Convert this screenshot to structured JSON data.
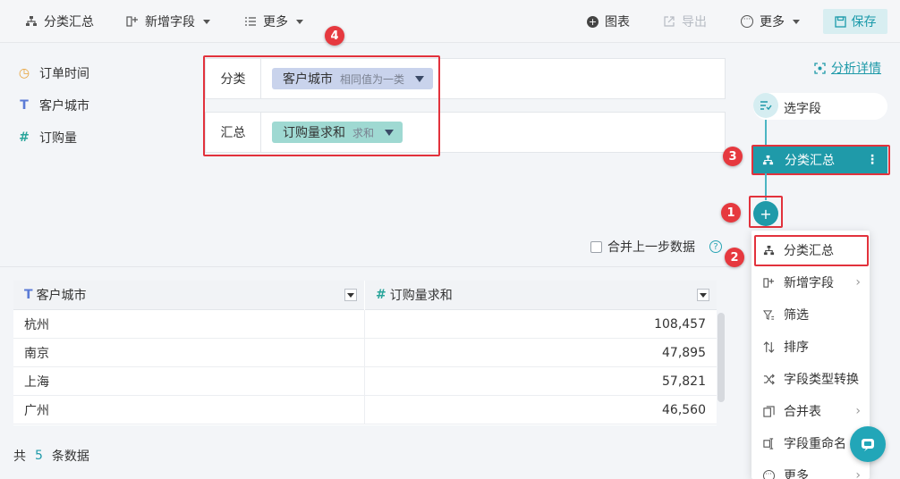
{
  "toolbar": {
    "group_summary": "分类汇总",
    "add_field": "新增字段",
    "more_left": "更多",
    "chart": "图表",
    "export": "导出",
    "more_right": "更多",
    "save": "保存"
  },
  "fields": [
    {
      "label": "订单时间",
      "icon": "clock-icon"
    },
    {
      "label": "客户城市",
      "icon": "text-type-icon"
    },
    {
      "label": "订购量",
      "icon": "number-type-icon"
    }
  ],
  "config": {
    "group_label": "分类",
    "group_field": "客户城市",
    "group_mode": "相同值为一类",
    "summary_label": "汇总",
    "summary_field": "订购量求和",
    "summary_mode": "求和"
  },
  "merge_checkbox_label": "合并上一步数据",
  "table": {
    "columns": [
      {
        "label": "客户城市",
        "type_icon": "T"
      },
      {
        "label": "订购量求和",
        "type_icon": "#"
      }
    ],
    "rows": [
      [
        "杭州",
        "108,457"
      ],
      [
        "南京",
        "47,895"
      ],
      [
        "上海",
        "57,821"
      ],
      [
        "广州",
        "46,560"
      ]
    ]
  },
  "footer": {
    "prefix": "共",
    "count": "5",
    "suffix": "条数据"
  },
  "right_panel": {
    "analysis_detail": "分析详情",
    "step_select": "选字段",
    "step_active": "分类汇总"
  },
  "menu": {
    "items": [
      {
        "label": "分类汇总",
        "icon": "group-icon",
        "submenu": false
      },
      {
        "label": "新增字段",
        "icon": "add-field-icon",
        "submenu": true
      },
      {
        "label": "筛选",
        "icon": "filter-icon",
        "submenu": false
      },
      {
        "label": "排序",
        "icon": "sort-icon",
        "submenu": false
      },
      {
        "label": "字段类型转换",
        "icon": "shuffle-icon",
        "submenu": false
      },
      {
        "label": "合并表",
        "icon": "merge-table-icon",
        "submenu": true
      },
      {
        "label": "字段重命名",
        "icon": "rename-icon",
        "submenu": false
      },
      {
        "label": "更多",
        "icon": "more-icon",
        "submenu": true
      }
    ]
  },
  "annotations": [
    "1",
    "2",
    "3",
    "4"
  ],
  "colors": {
    "accent": "#1f9aa9",
    "highlight": "#e2323c",
    "group_pill": "#c9d3ec",
    "summary_pill": "#9fd9d2"
  }
}
